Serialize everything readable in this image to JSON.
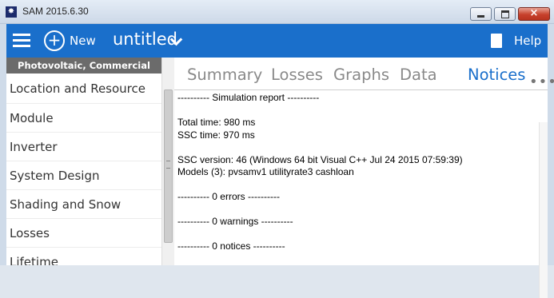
{
  "window": {
    "title": "SAM 2015.6.30",
    "icon": "sam-logo-icon",
    "controls": [
      "minimize-icon",
      "maximize-icon",
      "close-icon"
    ],
    "close_glyph": "×"
  },
  "toolbar": {
    "menu_icon": "hamburger-icon",
    "new_icon": "plus-circle-icon",
    "new_label": "New",
    "case_name": "untitled",
    "case_dropdown_icon": "chevron-down-icon",
    "doc_icon": "document-icon",
    "help_label": "Help",
    "accent_color": "#1a6fcb"
  },
  "sidebar": {
    "config_label": "Photovoltaic, Commercial",
    "items": [
      {
        "label": "Location and Resource"
      },
      {
        "label": "Module"
      },
      {
        "label": "Inverter"
      },
      {
        "label": "System Design"
      },
      {
        "label": "Shading and Snow"
      },
      {
        "label": "Losses"
      },
      {
        "label": "Lifetime"
      }
    ]
  },
  "results": {
    "tabs": [
      {
        "label": "Summary",
        "active": false
      },
      {
        "label": "Losses",
        "active": false
      },
      {
        "label": "Graphs",
        "active": false
      },
      {
        "label": "Data",
        "active": false
      },
      {
        "label": "Notices",
        "active": true
      }
    ],
    "more_icon": "more-horizontal-icon",
    "more_glyph": "•••",
    "report_lines": {
      "header": "---------- Simulation report ----------",
      "total_time": "Total time: 980 ms",
      "ssc_time": "SSC time: 970 ms",
      "ssc_version": "SSC version: 46 (Windows 64 bit Visual C++ Jul 24 2015 07:59:39)",
      "models": "Models (3): pvsamv1 utilityrate3 cashloan",
      "errors": "---------- 0 errors ----------",
      "warnings": "---------- 0 warnings ----------",
      "notices": "---------- 0 notices ----------"
    }
  }
}
